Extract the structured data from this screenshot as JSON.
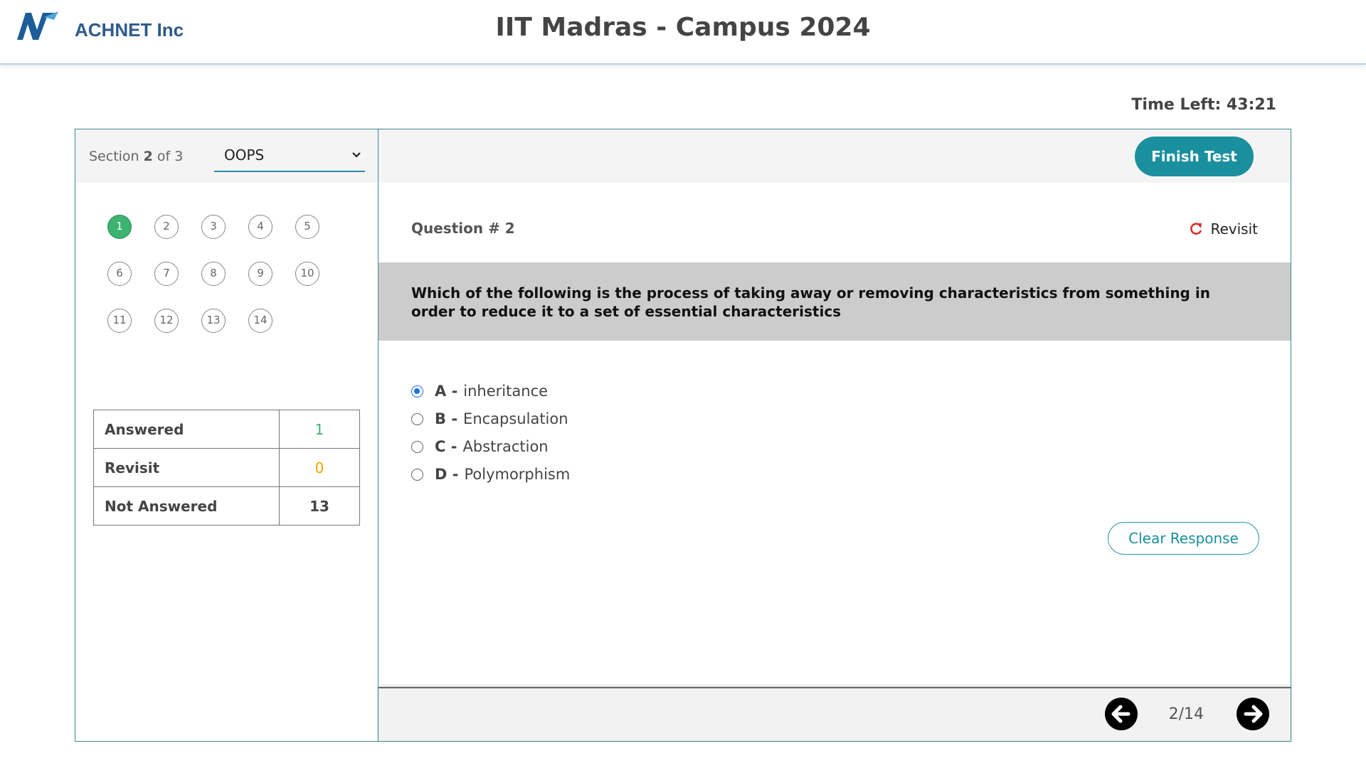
{
  "header": {
    "brand": "ACHNET Inc",
    "title": "IIT Madras - Campus 2024"
  },
  "timer": {
    "text": "Time Left: 43:21"
  },
  "section": {
    "prefix": "Section",
    "current": "2",
    "of_text": "of 3",
    "selected": "OOPS"
  },
  "question_grid": {
    "items": [
      "1",
      "2",
      "3",
      "4",
      "5",
      "6",
      "7",
      "8",
      "9",
      "10",
      "11",
      "12",
      "13",
      "14"
    ],
    "answered": [
      "1"
    ]
  },
  "stats": {
    "answered_label": "Answered",
    "answered_value": "1",
    "revisit_label": "Revisit",
    "revisit_value": "0",
    "not_answered_label": "Not Answered",
    "not_answered_value": "13"
  },
  "toolbar": {
    "finish_label": "Finish Test"
  },
  "question": {
    "header": "Question # 2",
    "revisit_label": "Revisit",
    "text": "Which of the following is the process of taking away or removing characteristics from something in order to reduce it to a set of essential characteristics",
    "options": [
      {
        "letter": "A -",
        "text": "inheritance",
        "selected": true
      },
      {
        "letter": "B -",
        "text": "Encapsulation",
        "selected": false
      },
      {
        "letter": "C -",
        "text": "Abstraction",
        "selected": false
      },
      {
        "letter": "D -",
        "text": "Polymorphism",
        "selected": false
      }
    ],
    "clear_label": "Clear Response"
  },
  "pager": {
    "text": "2/14"
  },
  "colors": {
    "brand": "#2d5b8c",
    "accent": "#1a8f9e",
    "answered": "#3cb371",
    "revisit": "#f0a500",
    "radio_selected": "#1a73e8"
  },
  "icons": {
    "logo": "achnet-logo",
    "revisit": "refresh-icon",
    "prev": "arrow-left-circle-icon",
    "next": "arrow-right-circle-icon",
    "dropdown": "chevron-down-icon"
  }
}
